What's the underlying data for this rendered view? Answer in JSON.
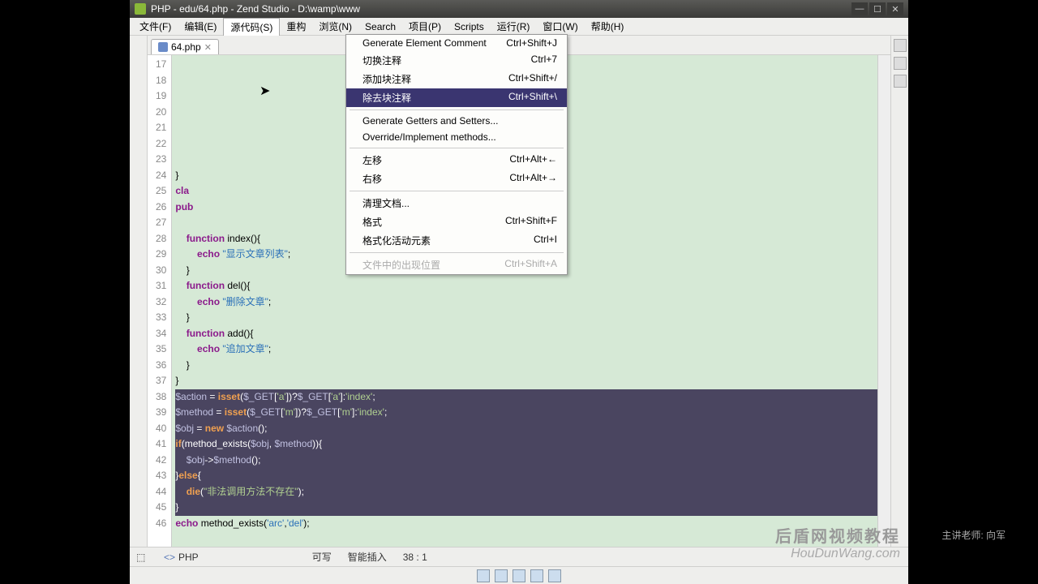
{
  "window": {
    "title": "PHP - edu/64.php - Zend Studio - D:\\wamp\\www"
  },
  "menubar": [
    "文件(F)",
    "编辑(E)",
    "源代码(S)",
    "重构",
    "浏览(N)",
    "Search",
    "项目(P)",
    "Scripts",
    "运行(R)",
    "窗口(W)",
    "帮助(H)"
  ],
  "active_menu_index": 2,
  "tab": {
    "label": "64.php"
  },
  "context_menu": [
    {
      "label": "Generate Element Comment",
      "shortcut": "Ctrl+Shift+J"
    },
    {
      "label": "切换注释",
      "shortcut": "Ctrl+7"
    },
    {
      "label": "添加块注释",
      "shortcut": "Ctrl+Shift+/"
    },
    {
      "label": "除去块注释",
      "shortcut": "Ctrl+Shift+\\",
      "hl": true
    },
    {
      "sep": true
    },
    {
      "label": "Generate Getters and Setters..."
    },
    {
      "label": "Override/Implement methods..."
    },
    {
      "sep": true
    },
    {
      "label": "左移",
      "shortcut": "Ctrl+Alt+←"
    },
    {
      "label": "右移",
      "shortcut": "Ctrl+Alt+→"
    },
    {
      "sep": true
    },
    {
      "label": "清理文档..."
    },
    {
      "label": "格式",
      "shortcut": "Ctrl+Shift+F"
    },
    {
      "label": "格式化活动元素",
      "shortcut": "Ctrl+I"
    },
    {
      "sep": true
    },
    {
      "label": "文件中的出现位置",
      "shortcut": "Ctrl+Shift+A",
      "disabled": true
    }
  ],
  "code_lines": [
    {
      "n": 17,
      "raw": " "
    },
    {
      "n": 18,
      "raw": " "
    },
    {
      "n": 19,
      "raw": " "
    },
    {
      "n": 20,
      "raw": " "
    },
    {
      "n": 21,
      "raw": " "
    },
    {
      "n": 22,
      "raw": " "
    },
    {
      "n": 23,
      "raw": " "
    },
    {
      "n": 24,
      "tokens": [
        [
          "",
          "}"
        ]
      ]
    },
    {
      "n": 25,
      "tokens": [
        [
          "kw",
          "cla"
        ]
      ]
    },
    {
      "n": 26,
      "tokens": [
        [
          "kw",
          "pub"
        ]
      ]
    },
    {
      "n": 27,
      "raw": " "
    },
    {
      "n": 28,
      "tokens": [
        [
          "",
          "    "
        ],
        [
          "kw",
          "function"
        ],
        [
          "",
          " index(){ "
        ]
      ]
    },
    {
      "n": 29,
      "tokens": [
        [
          "",
          "        "
        ],
        [
          "kw",
          "echo"
        ],
        [
          "",
          " "
        ],
        [
          "str",
          "\"显示文章列表\""
        ],
        [
          "",
          ";"
        ]
      ]
    },
    {
      "n": 30,
      "tokens": [
        [
          "",
          "    }"
        ]
      ]
    },
    {
      "n": 31,
      "tokens": [
        [
          "",
          "    "
        ],
        [
          "kw",
          "function"
        ],
        [
          "",
          " del(){"
        ]
      ]
    },
    {
      "n": 32,
      "tokens": [
        [
          "",
          "        "
        ],
        [
          "kw",
          "echo"
        ],
        [
          "",
          " "
        ],
        [
          "str",
          "\"删除文章\""
        ],
        [
          "",
          ";"
        ]
      ]
    },
    {
      "n": 33,
      "tokens": [
        [
          "",
          "    }"
        ]
      ]
    },
    {
      "n": 34,
      "tokens": [
        [
          "",
          "    "
        ],
        [
          "kw",
          "function"
        ],
        [
          "",
          " add(){"
        ]
      ]
    },
    {
      "n": 35,
      "tokens": [
        [
          "",
          "        "
        ],
        [
          "kw",
          "echo"
        ],
        [
          "",
          " "
        ],
        [
          "str",
          "\"追加文章\""
        ],
        [
          "",
          ";"
        ]
      ]
    },
    {
      "n": 36,
      "tokens": [
        [
          "",
          "    }"
        ]
      ]
    },
    {
      "n": 37,
      "tokens": [
        [
          "",
          "}"
        ]
      ]
    },
    {
      "n": 38,
      "sel": true,
      "tokens": [
        [
          "var",
          "$action"
        ],
        [
          "",
          " = "
        ],
        [
          "kw",
          "isset"
        ],
        [
          "",
          "("
        ],
        [
          "var",
          "$_GET"
        ],
        [
          "",
          "["
        ],
        [
          "str",
          "'a'"
        ],
        [
          "",
          "])?"
        ],
        [
          "var",
          "$_GET"
        ],
        [
          "",
          "["
        ],
        [
          "str",
          "'a'"
        ],
        [
          "",
          "]:"
        ],
        [
          "str",
          "'index'"
        ],
        [
          "",
          ";"
        ]
      ]
    },
    {
      "n": 39,
      "sel": true,
      "tokens": [
        [
          "var",
          "$method"
        ],
        [
          "",
          " = "
        ],
        [
          "kw",
          "isset"
        ],
        [
          "",
          "("
        ],
        [
          "var",
          "$_GET"
        ],
        [
          "",
          "["
        ],
        [
          "str",
          "'m'"
        ],
        [
          "",
          "])?"
        ],
        [
          "var",
          "$_GET"
        ],
        [
          "",
          "["
        ],
        [
          "str",
          "'m'"
        ],
        [
          "",
          "]:"
        ],
        [
          "str",
          "'index'"
        ],
        [
          "",
          ";"
        ]
      ]
    },
    {
      "n": 40,
      "sel": true,
      "tokens": [
        [
          "var",
          "$obj"
        ],
        [
          "",
          " = "
        ],
        [
          "kw",
          "new"
        ],
        [
          "",
          " "
        ],
        [
          "var",
          "$action"
        ],
        [
          "",
          "();"
        ]
      ]
    },
    {
      "n": 41,
      "sel": true,
      "tokens": [
        [
          "kw",
          "if"
        ],
        [
          "",
          "(method_exists("
        ],
        [
          "var",
          "$obj"
        ],
        [
          "",
          ", "
        ],
        [
          "var",
          "$method"
        ],
        [
          "",
          ")){"
        ]
      ]
    },
    {
      "n": 42,
      "sel": true,
      "tokens": [
        [
          "",
          "    "
        ],
        [
          "var",
          "$obj"
        ],
        [
          "",
          "->"
        ],
        [
          "var",
          "$method"
        ],
        [
          "",
          "();"
        ]
      ]
    },
    {
      "n": 43,
      "sel": true,
      "tokens": [
        [
          "",
          "}"
        ],
        [
          "kw",
          "else"
        ],
        [
          "",
          "{"
        ]
      ]
    },
    {
      "n": 44,
      "sel": true,
      "tokens": [
        [
          "",
          "    "
        ],
        [
          "kw",
          "die"
        ],
        [
          "",
          "("
        ],
        [
          "str",
          "\"非法调用方法不存在\""
        ],
        [
          "",
          ");"
        ]
      ]
    },
    {
      "n": 45,
      "sel": true,
      "tokens": [
        [
          "",
          "}"
        ]
      ]
    },
    {
      "n": 46,
      "tokens": [
        [
          "kw",
          "echo"
        ],
        [
          "",
          " method_exists("
        ],
        [
          "str",
          "'arc'"
        ],
        [
          "",
          ","
        ],
        [
          "str",
          "'del'"
        ],
        [
          "",
          ");"
        ]
      ]
    }
  ],
  "status": {
    "lang": "PHP",
    "write": "可写",
    "insert": "智能插入",
    "pos": "38 : 1"
  },
  "watermark": {
    "l1": "后盾网视频教程",
    "l2": "HouDunWang.com",
    "l3": "主讲老师: 向军"
  }
}
